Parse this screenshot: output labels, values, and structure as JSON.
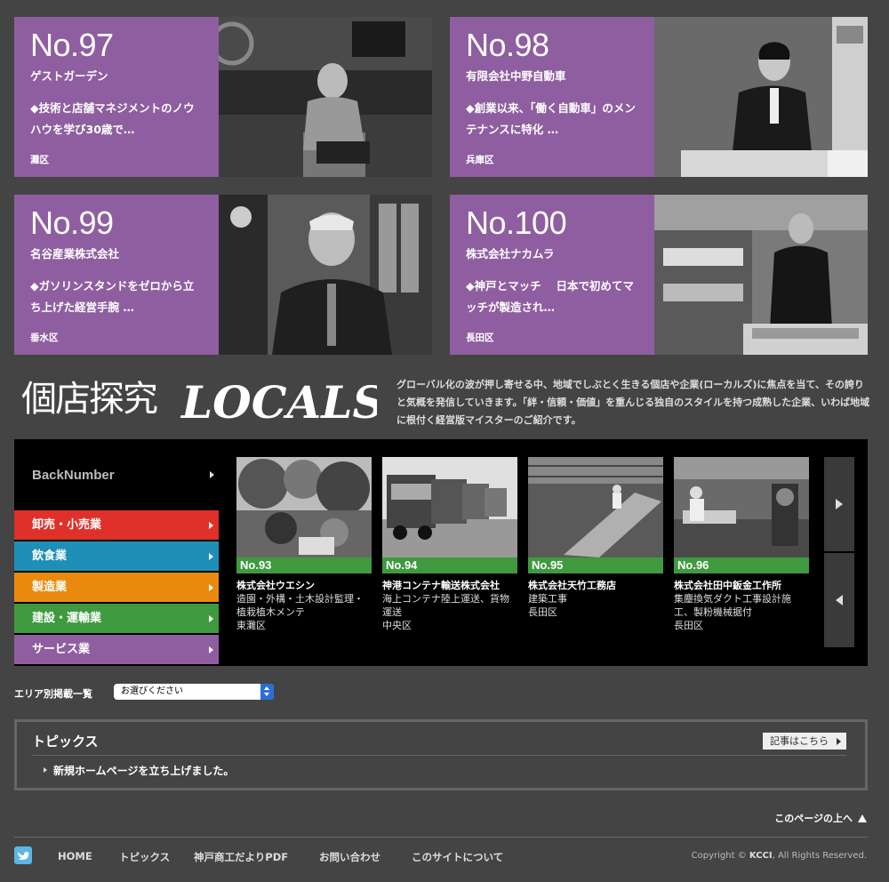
{
  "features": [
    {
      "num": "No.97",
      "name": "ゲストガーデン",
      "desc": "◆技術と店舗マネジメントのノウハウを学び30歳で…",
      "area": "灘区"
    },
    {
      "num": "No.98",
      "name": "有限会社中野自動車",
      "desc": "◆創業以来、「働く自動車」のメンテナンスに特化 …",
      "area": "兵庫区"
    },
    {
      "num": "No.99",
      "name": "名谷産業株式会社",
      "desc": "◆ガソリンスタンドをゼロから立ち上げた経営手腕 …",
      "area": "垂水区"
    },
    {
      "num": "No.100",
      "name": "株式会社ナカムラ",
      "desc": "◆神戸とマッチ　 日本で初めてマッチが製造され…",
      "area": "長田区"
    }
  ],
  "locals": {
    "logo_kanji": "個店探究",
    "logo_latin": "LOCALS",
    "description": "グローバル化の波が押し寄せる中、地域でしぶとく生きる個店や企業(ローカルズ)に焦点を当て、その誇りと気概を発信していきます。「絆・信頼・価値」を重んじる独自のスタイルを持つ成熟した企業、いわば地域に根付く経営版マイスターのご紹介です。"
  },
  "backnumber": {
    "title": "BackNumber",
    "categories": [
      {
        "label": "卸売・小売業",
        "color": "#e0302a"
      },
      {
        "label": "飲食業",
        "color": "#1f8fb8"
      },
      {
        "label": "製造業",
        "color": "#e98a0e"
      },
      {
        "label": "建設・運輸業",
        "color": "#3f9a3f"
      },
      {
        "label": "サービス業",
        "color": "#8f5ea0"
      }
    ],
    "items": [
      {
        "num": "No.93",
        "company": "株式会社ウエシン",
        "desc": "造園・外構・土木設計監理・植栽植木メンテ",
        "area": "東灘区"
      },
      {
        "num": "No.94",
        "company": "神港コンテナ輸送株式会社",
        "desc": "海上コンテナ陸上運送、貨物運送",
        "area": "中央区"
      },
      {
        "num": "No.95",
        "company": "株式会社天竹工務店",
        "desc": "建築工事",
        "area": "長田区"
      },
      {
        "num": "No.96",
        "company": "株式会社田中鈑金工作所",
        "desc": "集塵換気ダクト工事設計施工、製粉機械据付",
        "area": "長田区"
      }
    ]
  },
  "area_select": {
    "label": "エリア別掲載一覧",
    "selected": "お選びください"
  },
  "topics": {
    "title": "トピックス",
    "more_label": "記事はこちら",
    "items": [
      "新規ホームページを立ち上げました。"
    ]
  },
  "footer": {
    "pagetop": "このページの上へ",
    "nav": [
      "HOME",
      "トピックス",
      "神戸商工だよりPDF",
      "お問い合わせ",
      "このサイトについて"
    ],
    "copyright_prefix": "Copyright ©",
    "copyright_brand": "KCCI",
    "copyright_suffix": ", All Rights Reserved."
  }
}
